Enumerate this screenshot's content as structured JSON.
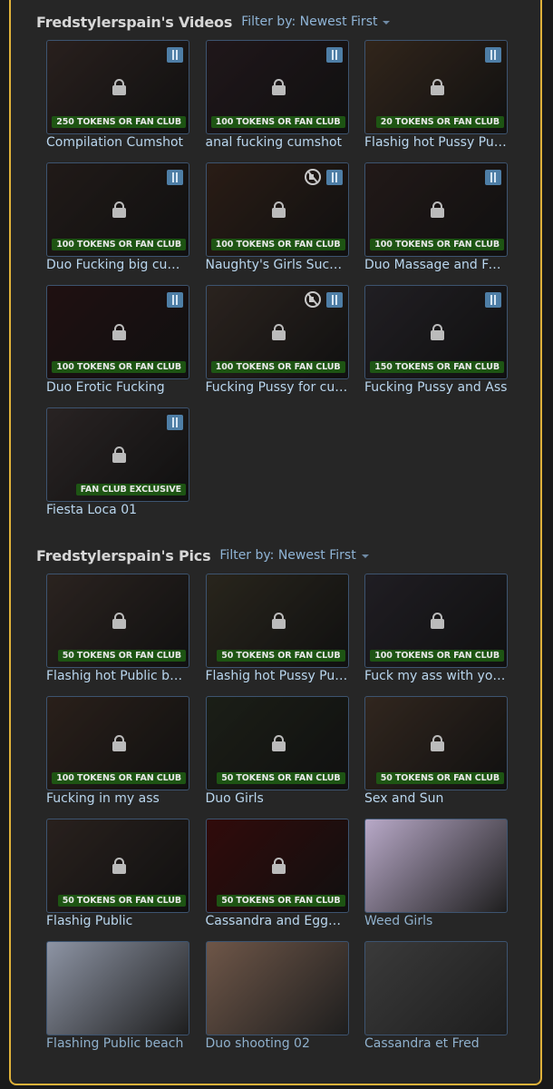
{
  "videos": {
    "title": "Fredstylerspain's Videos",
    "filter": "Filter by: Newest First",
    "items": [
      {
        "title": "Compilation Cumshot",
        "badge": "250 TOKENS OR FAN CLUB",
        "muted": false,
        "tint": "#4a3a36"
      },
      {
        "title": "anal fucking cumshot",
        "badge": "100 TOKENS OR FAN CLUB",
        "muted": false,
        "tint": "#3a2a30"
      },
      {
        "title": "Flashig hot Pussy Public",
        "badge": "20 TOKENS OR FAN CLUB",
        "muted": false,
        "tint": "#5a4432"
      },
      {
        "title": "Duo Fucking big cumshot",
        "badge": "100 TOKENS OR FAN CLUB",
        "muted": false,
        "tint": "#3c302c"
      },
      {
        "title": "Naughty's Girls Sucking",
        "badge": "100 TOKENS OR FAN CLUB",
        "muted": true,
        "tint": "#4c3428"
      },
      {
        "title": "Duo Massage and Fucking",
        "badge": "100 TOKENS OR FAN CLUB",
        "muted": false,
        "tint": "#3e2e2c"
      },
      {
        "title": "Duo Erotic Fucking",
        "badge": "100 TOKENS OR FAN CLUB",
        "muted": false,
        "tint": "#3a1e20"
      },
      {
        "title": "Fucking Pussy for cumshot",
        "badge": "100 TOKENS OR FAN CLUB",
        "muted": true,
        "tint": "#4e4038"
      },
      {
        "title": "Fucking Pussy and Ass",
        "badge": "150 TOKENS OR FAN CLUB",
        "muted": false,
        "tint": "#3c3840"
      },
      {
        "title": "Fiesta Loca 01",
        "badge": "FAN CLUB EXCLUSIVE",
        "muted": false,
        "tint": "#4a4040"
      }
    ]
  },
  "pics": {
    "title": "Fredstylerspain's Pics",
    "filter": "Filter by: Newest First",
    "items": [
      {
        "title": "Flashig hot Public beach",
        "badge": "50 TOKENS OR FAN CLUB",
        "locked": true,
        "tint": "#4e403a"
      },
      {
        "title": "Flashig hot Pussy Public",
        "badge": "50 TOKENS OR FAN CLUB",
        "locked": true,
        "tint": "#4a4434"
      },
      {
        "title": "Fuck my ass with your cock",
        "badge": "100 TOKENS OR FAN CLUB",
        "locked": true,
        "tint": "#3a3640"
      },
      {
        "title": "Fucking in my ass",
        "badge": "100 TOKENS OR FAN CLUB",
        "locked": true,
        "tint": "#4c3a30"
      },
      {
        "title": "Duo Girls",
        "badge": "50 TOKENS OR FAN CLUB",
        "locked": true,
        "tint": "#32382a"
      },
      {
        "title": "Sex and Sun",
        "badge": "50 TOKENS OR FAN CLUB",
        "locked": true,
        "tint": "#5a4638"
      },
      {
        "title": "Flashig Public",
        "badge": "50 TOKENS OR FAN CLUB",
        "locked": true,
        "tint": "#4a3c36"
      },
      {
        "title": "Cassandra and Eggplant",
        "badge": "50 TOKENS OR FAN CLUB",
        "locked": true,
        "tint": "#5a1414"
      },
      {
        "title": "Weed Girls",
        "badge": "",
        "locked": false,
        "tint": "#b8a9c8"
      },
      {
        "title": "Flashing Public beach",
        "badge": "",
        "locked": false,
        "tint": "#8d94a4"
      },
      {
        "title": "Duo shooting 02",
        "badge": "",
        "locked": false,
        "tint": "#6e5648"
      },
      {
        "title": "Cassandra et Fred",
        "badge": "",
        "locked": false,
        "tint": "#3a3a3a"
      }
    ]
  }
}
